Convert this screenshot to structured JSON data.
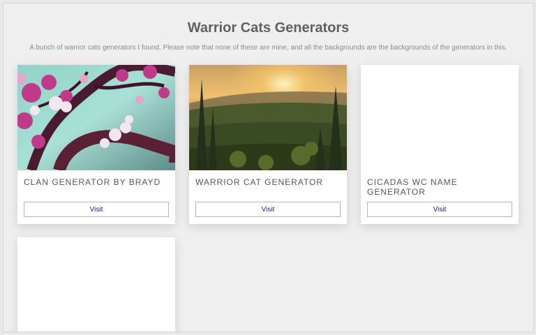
{
  "page": {
    "title": "Warrior Cats Generators",
    "subtitle": "A bunch of warrior cats generators I found. Please note that none of these are mine, and all the backgrounds are the backgrounds of the generators in this."
  },
  "cards": [
    {
      "title": "Clan Generator by Brayd",
      "button_label": "Visit",
      "image": "cherry-blossom-photo"
    },
    {
      "title": "Warrior Cat Generator",
      "button_label": "Visit",
      "image": "forest-sunset-photo"
    },
    {
      "title": "Cicadas WC Name Generator",
      "button_label": "Visit",
      "image": "none"
    },
    {
      "title": "",
      "button_label": "",
      "image": "none"
    }
  ],
  "colors": {
    "background": "#efefef",
    "card": "#ffffff",
    "link": "#1a1aa6",
    "title": "#606060"
  }
}
